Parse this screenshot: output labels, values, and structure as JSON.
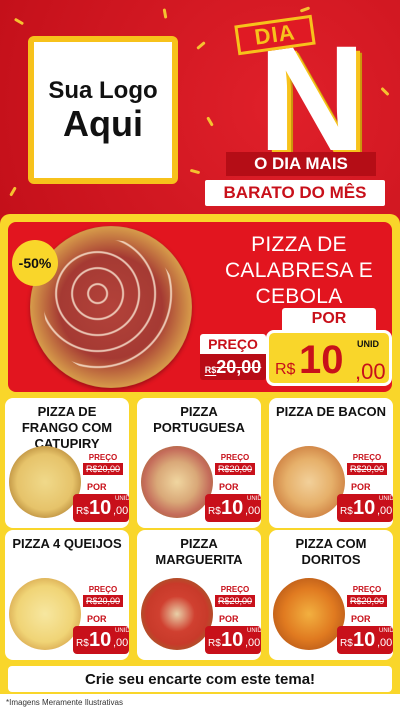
{
  "header": {
    "logo_line1": "Sua Logo",
    "logo_line2": "Aqui",
    "dia_tag": "DIA",
    "big_letter": "N",
    "slogan_line1": "O DIA MAIS",
    "slogan_line2": "BARATO DO MÊS"
  },
  "featured": {
    "discount": "-50%",
    "title": "PIZZA DE CALABRESA E CEBOLA",
    "por_label": "POR",
    "preco_label": "PREÇO",
    "old_price_currency": "R$",
    "old_price": "20,00",
    "currency": "R$",
    "price_int": "10",
    "price_dec": ",00",
    "unit": "UNID"
  },
  "cards": [
    {
      "title": "PIZZA DE FRANGO COM CATUPIRY",
      "preco_label": "PREÇO",
      "old_price": "R$20,00",
      "por_label": "POR",
      "currency": "R$",
      "price_int": "10",
      "price_dec": ",00",
      "unit": "UNID"
    },
    {
      "title": "PIZZA PORTUGUESA",
      "preco_label": "PREÇO",
      "old_price": "R$20,00",
      "por_label": "POR",
      "currency": "R$",
      "price_int": "10",
      "price_dec": ",00",
      "unit": "UNID"
    },
    {
      "title": "PIZZA DE BACON",
      "preco_label": "PREÇO",
      "old_price": "R$20,00",
      "por_label": "POR",
      "currency": "R$",
      "price_int": "10",
      "price_dec": ",00",
      "unit": "UNID"
    },
    {
      "title": "PIZZA 4 QUEIJOS",
      "preco_label": "PREÇO",
      "old_price": "R$20,00",
      "por_label": "POR",
      "currency": "R$",
      "price_int": "10",
      "price_dec": ",00",
      "unit": "UNID"
    },
    {
      "title": "PIZZA MARGUERITA",
      "preco_label": "PREÇO",
      "old_price": "R$20,00",
      "por_label": "POR",
      "currency": "R$",
      "price_int": "10",
      "price_dec": ",00",
      "unit": "UNID"
    },
    {
      "title": "PIZZA COM DORITOS",
      "preco_label": "PREÇO",
      "old_price": "R$20,00",
      "por_label": "POR",
      "currency": "R$",
      "price_int": "10",
      "price_dec": ",00",
      "unit": "UNID"
    }
  ],
  "cta": {
    "text": "Crie seu encarte com este tema!"
  },
  "footer": {
    "disclaimer": "*Imagens Meramente Ilustrativas"
  },
  "colors": {
    "brand_red": "#c8101a",
    "brand_yellow": "#f9d62a",
    "accent_gold": "#f7c21b"
  }
}
